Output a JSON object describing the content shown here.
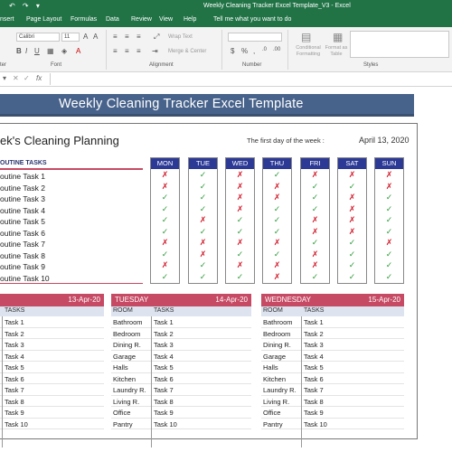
{
  "window": {
    "title": "Weekly Cleaning Tracker Excel Template_V3  -  Excel",
    "quick_access": "↶ ↷ ▾"
  },
  "menu": [
    "nsert",
    "Page Layout",
    "Formulas",
    "Data",
    "Review",
    "View",
    "Help",
    "Tell me what you want to do"
  ],
  "ribbon": {
    "font_name": "Calibri",
    "font_size": "11",
    "wrap_text": "Wrap Text",
    "merge_center": "Merge & Center",
    "cond_formatting": "Conditional Formatting",
    "format_as_table": "Format as Table",
    "groups": {
      "clipboard": "ter",
      "font": "Font",
      "alignment": "Alignment",
      "number": "Number",
      "styles": "Styles"
    }
  },
  "formula_bar": {
    "fx": "fx"
  },
  "sheet": {
    "banner": "Weekly Cleaning Tracker Excel Template",
    "heading": "ek's Cleaning Planning",
    "first_day_label": "The first day of the week :",
    "first_day_value": "April 13, 2020",
    "routine_label": "OUTINE TASKS",
    "routine_tasks": [
      "outine Task 1",
      "outine Task 2",
      "outine Task 3",
      "outine Task 4",
      "outine Task 5",
      "outine Task 6",
      "outine Task 7",
      "outine Task 8",
      "outine Task 9",
      "outine Task 10"
    ],
    "days": [
      {
        "name": "MON",
        "marks": [
          "x",
          "x",
          "v",
          "v",
          "v",
          "v",
          "x",
          "v",
          "x",
          "v"
        ]
      },
      {
        "name": "TUE",
        "marks": [
          "v",
          "v",
          "v",
          "v",
          "x",
          "v",
          "x",
          "x",
          "v",
          "v"
        ]
      },
      {
        "name": "WED",
        "marks": [
          "x",
          "x",
          "x",
          "x",
          "v",
          "v",
          "x",
          "v",
          "x",
          "v"
        ]
      },
      {
        "name": "THU",
        "marks": [
          "v",
          "x",
          "x",
          "v",
          "v",
          "v",
          "x",
          "v",
          "x",
          "x"
        ]
      },
      {
        "name": "FRI",
        "marks": [
          "x",
          "v",
          "v",
          "v",
          "x",
          "x",
          "v",
          "x",
          "x",
          "v"
        ]
      },
      {
        "name": "SAT",
        "marks": [
          "x",
          "v",
          "x",
          "x",
          "x",
          "x",
          "v",
          "v",
          "v",
          "v"
        ]
      },
      {
        "name": "SUN",
        "marks": [
          "x",
          "x",
          "v",
          "v",
          "v",
          "v",
          "x",
          "v",
          "v",
          "v"
        ]
      }
    ],
    "panels": [
      {
        "name": "",
        "date": "13-Apr-20",
        "col2": "TASKS",
        "rooms": [
          "",
          "",
          "",
          "",
          "",
          "",
          "",
          "",
          "",
          ""
        ],
        "tasks": [
          "Task 1",
          "Task 2",
          "Task 3",
          "Task 4",
          "Task 5",
          "Task 6",
          "Task 7",
          "Task 8",
          "Task 9",
          "Task 10"
        ]
      },
      {
        "name": "TUESDAY",
        "date": "14-Apr-20",
        "col1": "ROOM",
        "col2": "TASKS",
        "rooms": [
          "Bathroom",
          "Bedroom",
          "Dining R.",
          "Garage",
          "Halls",
          "Kitchen",
          "Laundry R.",
          "Living R.",
          "Office",
          "Pantry"
        ],
        "tasks": [
          "Task 1",
          "Task 2",
          "Task 3",
          "Task 4",
          "Task 5",
          "Task 6",
          "Task 7",
          "Task 8",
          "Task 9",
          "Task 10"
        ]
      },
      {
        "name": "WEDNESDAY",
        "date": "15-Apr-20",
        "col1": "ROOM",
        "col2": "TASKS",
        "rooms": [
          "Bathroom",
          "Bedroom",
          "Dining R.",
          "Garage",
          "Halls",
          "Kitchen",
          "Laundry R.",
          "Living R.",
          "Office",
          "Pantry"
        ],
        "tasks": [
          "Task 1",
          "Task 2",
          "Task 3",
          "Task 4",
          "Task 5",
          "Task 6",
          "Task 7",
          "Task 8",
          "Task 9",
          "Task 10"
        ]
      }
    ],
    "colors": {
      "banner": "#48638b",
      "day_header": "#2c3a96",
      "accent": "#c64a64",
      "check": "#2e9c3a",
      "cross": "#d11a2a"
    }
  }
}
